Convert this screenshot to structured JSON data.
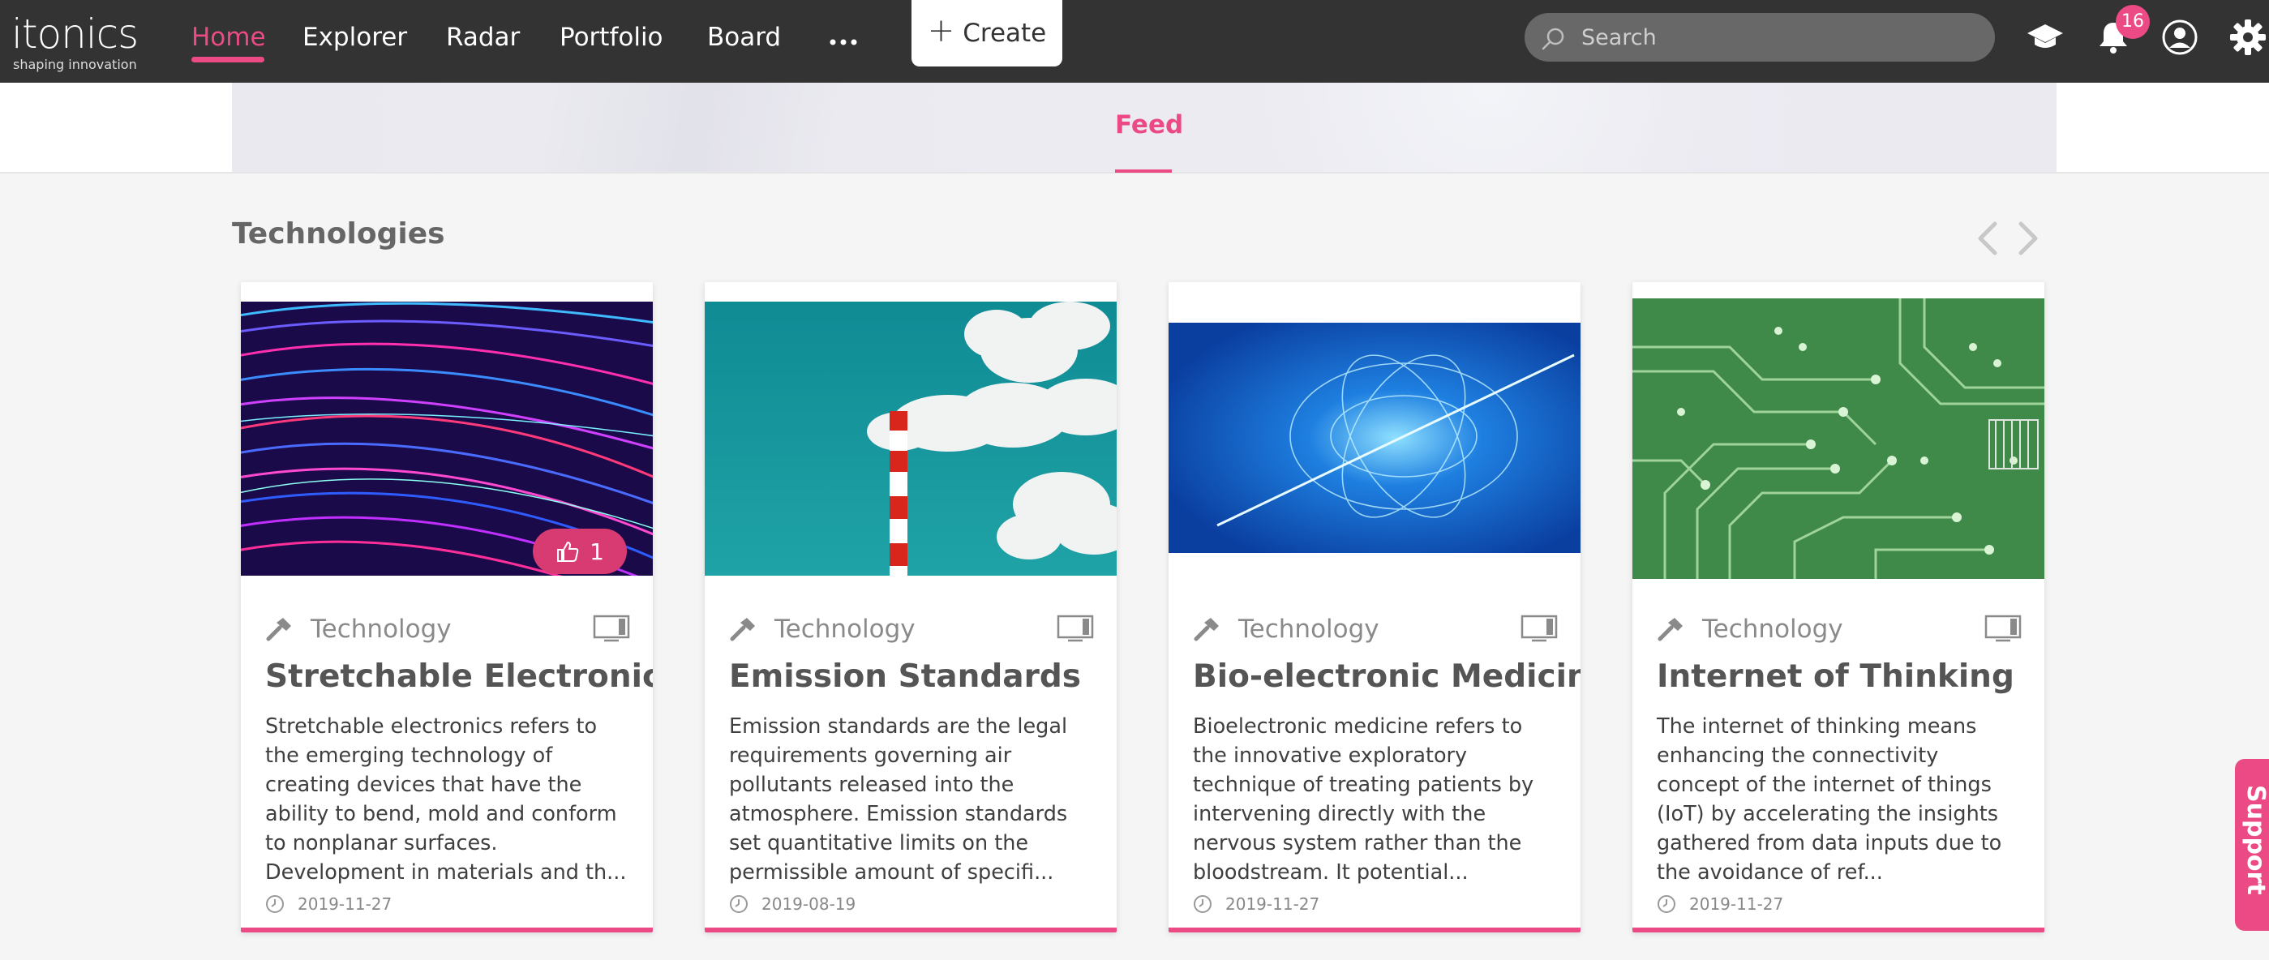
{
  "brand": {
    "name": "itonics",
    "tagline": "shaping innovation"
  },
  "nav": {
    "items": [
      {
        "label": "Home",
        "active": true
      },
      {
        "label": "Explorer"
      },
      {
        "label": "Radar"
      },
      {
        "label": "Portfolio"
      },
      {
        "label": "Board"
      }
    ],
    "more_icon": "ellipsis-icon",
    "create_label": "Create"
  },
  "search": {
    "placeholder": "Search",
    "value": ""
  },
  "header_icons": {
    "learn_icon": "graduation-cap-icon",
    "notifications_icon": "bell-icon",
    "notifications_count": "16",
    "profile_icon": "user-circle-icon",
    "settings_icon": "gear-icon"
  },
  "tabs": {
    "feed": "Feed"
  },
  "section": {
    "title": "Technologies"
  },
  "cards": [
    {
      "type": "Technology",
      "title": "Stretchable Electronics",
      "description": "Stretchable electronics refers to the emerging technology of creating devices that have the ability to bend, mold and conform to nonplanar surfaces. Development in materials and th...",
      "date": "2019-11-27",
      "likes": "1"
    },
    {
      "type": "Technology",
      "title": "Emission Standards",
      "description": "Emission standards are the legal requirements governing air pollutants released into the atmosphere. Emission standards set quantitative limits on the permissible amount of specifi...",
      "date": "2019-08-19"
    },
    {
      "type": "Technology",
      "title": "Bio-electronic Medicine",
      "description": "Bioelectronic medicine refers to the innovative exploratory technique of treating patients by intervening directly with the nervous system rather than the bloodstream. It potential...",
      "date": "2019-11-27"
    },
    {
      "type": "Technology",
      "title": "Internet of Thinking",
      "description": "The internet of thinking means enhancing the connectivity concept of the internet of things (IoT) by accelerating the insights gathered from data inputs due to the avoidance of ref...",
      "date": "2019-11-27"
    }
  ],
  "support": {
    "label": "Support"
  },
  "colors": {
    "accent": "#ec4a84",
    "topbar": "#333333",
    "background": "#f5f5f5"
  }
}
